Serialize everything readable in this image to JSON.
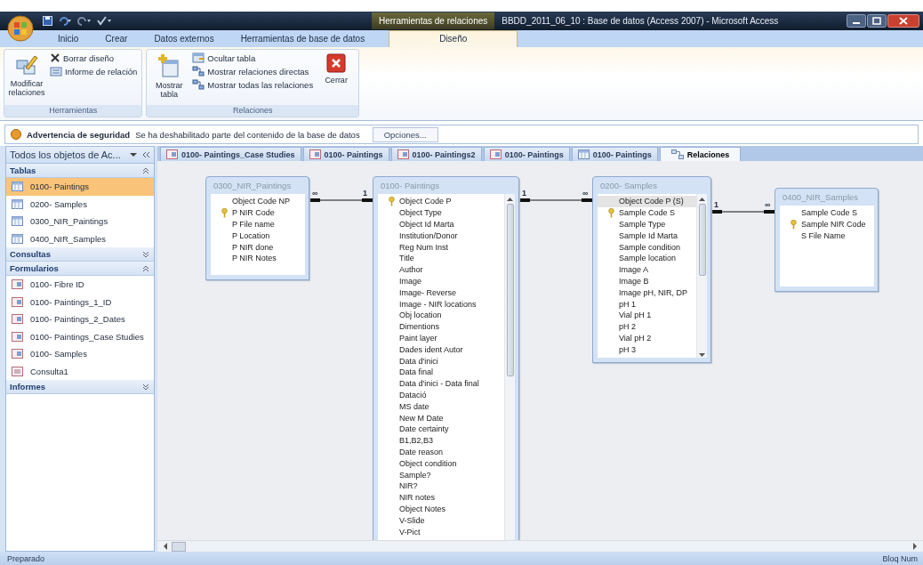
{
  "window": {
    "context_tab": "Herramientas de relaciones",
    "title": "BBDD_2011_06_10 : Base de datos (Access 2007) - Microsoft Access"
  },
  "ribbon_tabs": [
    {
      "label": "Inicio",
      "selected": false
    },
    {
      "label": "Crear",
      "selected": false
    },
    {
      "label": "Datos externos",
      "selected": false
    },
    {
      "label": "Herramientas de base de datos",
      "selected": false
    },
    {
      "label": "Diseño",
      "selected": true
    }
  ],
  "ribbon_groups": [
    {
      "label": "Herramientas",
      "commands": [
        {
          "kind": "large",
          "label": "Modificar relaciones"
        },
        {
          "kind": "stack",
          "items": [
            {
              "label": "Borrar diseño"
            },
            {
              "label": "Informe de relación"
            }
          ]
        }
      ]
    },
    {
      "label": "Relaciones",
      "commands": [
        {
          "kind": "large",
          "label": "Mostrar tabla"
        },
        {
          "kind": "stack",
          "items": [
            {
              "label": "Ocultar tabla"
            },
            {
              "label": "Mostrar relaciones directas"
            },
            {
              "label": "Mostrar todas las relaciones"
            }
          ]
        },
        {
          "kind": "large",
          "label": "Cerrar"
        }
      ]
    }
  ],
  "security_bar": {
    "title": "Advertencia de seguridad",
    "message": "Se ha deshabilitado parte del contenido de la base de datos",
    "button": "Opciones..."
  },
  "nav_pane": {
    "title": "Todos los objetos de Ac...",
    "groups": [
      {
        "label": "Tablas",
        "expanded": true,
        "items": [
          {
            "label": "0100- Paintings",
            "kind": "table",
            "selected": true
          },
          {
            "label": "0200- Samples",
            "kind": "table",
            "selected": false
          },
          {
            "label": "0300_NIR_Paintings",
            "kind": "table",
            "selected": false
          },
          {
            "label": "0400_NIR_Samples",
            "kind": "table",
            "selected": false
          }
        ]
      },
      {
        "label": "Consultas",
        "expanded": false
      },
      {
        "label": "Formularios",
        "expanded": true,
        "items": [
          {
            "label": "0100- Fibre ID",
            "kind": "form",
            "selected": false
          },
          {
            "label": "0100- Paintings_1_ID",
            "kind": "form",
            "selected": false
          },
          {
            "label": "0100- Paintings_2_Dates",
            "kind": "form",
            "selected": false
          },
          {
            "label": "0100- Paintings_Case Studies",
            "kind": "form",
            "selected": false
          },
          {
            "label": "0100- Samples",
            "kind": "form",
            "selected": false
          },
          {
            "label": "Consulta1",
            "kind": "query",
            "selected": false
          }
        ]
      },
      {
        "label": "Informes",
        "expanded": false
      }
    ]
  },
  "document_tabs": [
    {
      "label": "0100- Paintings_Case Studies",
      "kind": "form",
      "selected": false
    },
    {
      "label": "0100- Paintings",
      "kind": "form",
      "selected": false
    },
    {
      "label": "0100- Paintings2",
      "kind": "form",
      "selected": false
    },
    {
      "label": "0100- Paintings",
      "kind": "form",
      "selected": false
    },
    {
      "label": "0100- Paintings",
      "kind": "table",
      "selected": false
    },
    {
      "label": "Relaciones",
      "kind": "relationships",
      "selected": true
    }
  ],
  "tables": [
    {
      "title": "0300_NIR_Paintings",
      "scrollable": false,
      "fields": [
        {
          "name": "Object Code NP",
          "key": false,
          "selected": false
        },
        {
          "name": "P NIR Code",
          "key": true,
          "selected": false
        },
        {
          "name": "P File name",
          "key": false,
          "selected": false
        },
        {
          "name": "P Location",
          "key": false,
          "selected": false
        },
        {
          "name": "P NIR done",
          "key": false,
          "selected": false
        },
        {
          "name": "P NIR Notes",
          "key": false,
          "selected": false
        }
      ]
    },
    {
      "title": "0100- Paintings",
      "scrollable": true,
      "fields": [
        {
          "name": "Object Code P",
          "key": true,
          "selected": false
        },
        {
          "name": "Object Type",
          "key": false,
          "selected": false
        },
        {
          "name": "Object Id Marta",
          "key": false,
          "selected": false
        },
        {
          "name": "Institution/Donor",
          "key": false,
          "selected": false
        },
        {
          "name": "Reg Num Inst",
          "key": false,
          "selected": false
        },
        {
          "name": "Title",
          "key": false,
          "selected": false
        },
        {
          "name": "Author",
          "key": false,
          "selected": false
        },
        {
          "name": "Image",
          "key": false,
          "selected": false
        },
        {
          "name": "Image- Reverse",
          "key": false,
          "selected": false
        },
        {
          "name": "Image - NIR locations",
          "key": false,
          "selected": false
        },
        {
          "name": "Obj location",
          "key": false,
          "selected": false
        },
        {
          "name": "Dimentions",
          "key": false,
          "selected": false
        },
        {
          "name": "Paint layer",
          "key": false,
          "selected": false
        },
        {
          "name": "Dades ident Autor",
          "key": false,
          "selected": false
        },
        {
          "name": "Data d'inici",
          "key": false,
          "selected": false
        },
        {
          "name": "Data final",
          "key": false,
          "selected": false
        },
        {
          "name": "Data d'inici - Data final",
          "key": false,
          "selected": false
        },
        {
          "name": "Datació",
          "key": false,
          "selected": false
        },
        {
          "name": "MS date",
          "key": false,
          "selected": false
        },
        {
          "name": "New M Date",
          "key": false,
          "selected": false
        },
        {
          "name": "Date certainty",
          "key": false,
          "selected": false
        },
        {
          "name": "B1,B2,B3",
          "key": false,
          "selected": false
        },
        {
          "name": "Date reason",
          "key": false,
          "selected": false
        },
        {
          "name": "Object condition",
          "key": false,
          "selected": false
        },
        {
          "name": "Sample?",
          "key": false,
          "selected": false
        },
        {
          "name": "NIR?",
          "key": false,
          "selected": false
        },
        {
          "name": "NIR notes",
          "key": false,
          "selected": false
        },
        {
          "name": "Object Notes",
          "key": false,
          "selected": false
        },
        {
          "name": "V-Slide",
          "key": false,
          "selected": false
        },
        {
          "name": "V-Pict",
          "key": false,
          "selected": false
        }
      ]
    },
    {
      "title": "0200- Samples",
      "scrollable": true,
      "fields": [
        {
          "name": "Object Code P (S)",
          "key": false,
          "selected": true
        },
        {
          "name": "Sample Code S",
          "key": true,
          "selected": false
        },
        {
          "name": "Sample Type",
          "key": false,
          "selected": false
        },
        {
          "name": "Sample Id Marta",
          "key": false,
          "selected": false
        },
        {
          "name": "Sample condition",
          "key": false,
          "selected": false
        },
        {
          "name": "Sample location",
          "key": false,
          "selected": false
        },
        {
          "name": "Image A",
          "key": false,
          "selected": false
        },
        {
          "name": "Image B",
          "key": false,
          "selected": false
        },
        {
          "name": "Image pH, NIR, DP",
          "key": false,
          "selected": false
        },
        {
          "name": "pH 1",
          "key": false,
          "selected": false
        },
        {
          "name": "Vial pH 1",
          "key": false,
          "selected": false
        },
        {
          "name": "pH 2",
          "key": false,
          "selected": false
        },
        {
          "name": "Vial pH 2",
          "key": false,
          "selected": false
        },
        {
          "name": "pH 3",
          "key": false,
          "selected": false
        }
      ]
    },
    {
      "title": "0400_NIR_Samples",
      "scrollable": false,
      "fields": [
        {
          "name": "Sample Code S",
          "key": false,
          "selected": false
        },
        {
          "name": "Sample NIR Code",
          "key": true,
          "selected": false
        },
        {
          "name": "S File Name",
          "key": false,
          "selected": false
        }
      ]
    }
  ],
  "relationships": [
    {
      "left_end": "∞",
      "right_end": "1"
    },
    {
      "left_end": "1",
      "right_end": "∞"
    },
    {
      "left_end": "1",
      "right_end": "∞"
    }
  ],
  "status_bar": {
    "left": "Preparado",
    "right": "Bloq Num"
  }
}
